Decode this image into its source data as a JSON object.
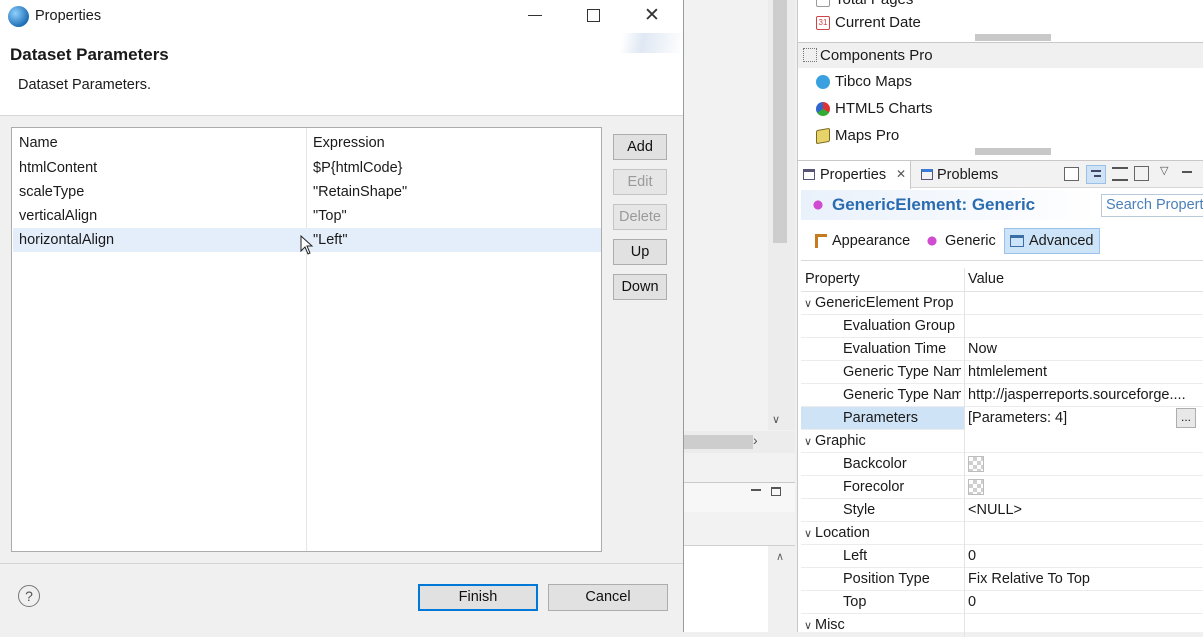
{
  "dialog": {
    "title": "Properties",
    "header_title": "Dataset Parameters",
    "header_desc": "Dataset Parameters.",
    "columns": [
      "Name",
      "Expression"
    ],
    "rows": [
      {
        "name": "htmlContent",
        "expr": "$P{htmlCode}"
      },
      {
        "name": "scaleType",
        "expr": "\"RetainShape\""
      },
      {
        "name": "verticalAlign",
        "expr": "\"Top\""
      },
      {
        "name": "horizontalAlign",
        "expr": "\"Left\""
      }
    ],
    "buttons": {
      "add": "Add",
      "edit": "Edit",
      "delete": "Delete",
      "up": "Up",
      "down": "Down"
    },
    "finish": "Finish",
    "cancel": "Cancel",
    "help": "?"
  },
  "palette": {
    "items_top": [
      "Total Pages",
      "Current Date"
    ],
    "section_pro": "Components Pro",
    "items_pro": [
      "Tibco Maps",
      "HTML5 Charts",
      "Maps Pro"
    ]
  },
  "properties_view": {
    "tabs": {
      "properties": "Properties",
      "problems": "Problems"
    },
    "element_title": "GenericElement: Generic",
    "search_placeholder": "Search Propert",
    "subtabs": {
      "appearance": "Appearance",
      "generic": "Generic",
      "advanced": "Advanced"
    },
    "columns": {
      "property": "Property",
      "value": "Value"
    },
    "groups": {
      "generic": "GenericElement Prop",
      "graphic": "Graphic",
      "location": "Location",
      "misc": "Misc"
    },
    "rows": {
      "eval_group": {
        "name": "Evaluation Group",
        "value": ""
      },
      "eval_time": {
        "name": "Evaluation Time",
        "value": "Now"
      },
      "gen_type_name": {
        "name": "Generic Type Nam",
        "value": "htmlelement"
      },
      "gen_type_ns": {
        "name": "Generic Type Nam",
        "value": "http://jasperreports.sourceforge...."
      },
      "parameters": {
        "name": "Parameters",
        "value": "[Parameters: 4]"
      },
      "backcolor": {
        "name": "Backcolor"
      },
      "forecolor": {
        "name": "Forecolor"
      },
      "style": {
        "name": "Style",
        "value": "<NULL>"
      },
      "left": {
        "name": "Left",
        "value": "0"
      },
      "position_type": {
        "name": "Position Type",
        "value": "Fix Relative To Top"
      },
      "top": {
        "name": "Top",
        "value": "0"
      }
    },
    "ellipsis": "..."
  },
  "colors": {
    "accent": "#0078d7",
    "selection": "#e4eefa",
    "prop_title": "#2b6cb0"
  }
}
